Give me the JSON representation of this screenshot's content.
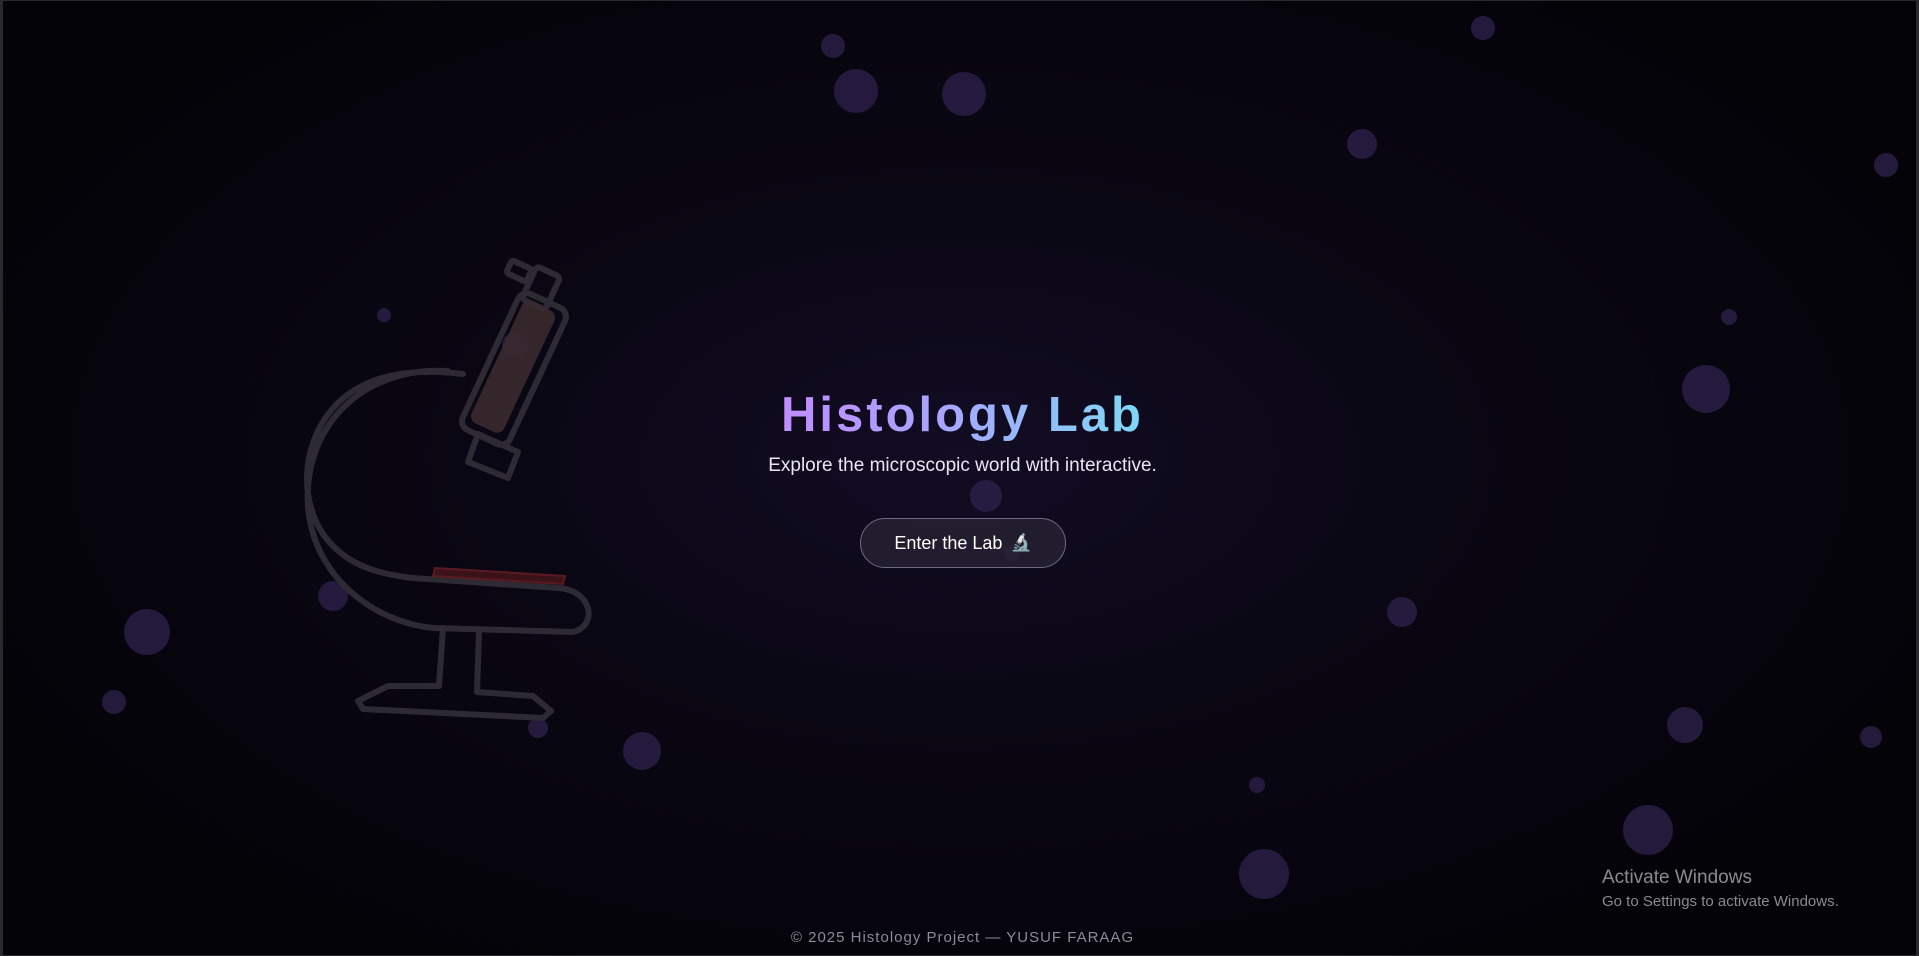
{
  "hero": {
    "title": "Histology Lab",
    "subtitle": "Explore the microscopic world with interactive."
  },
  "cta": {
    "label": "Enter the Lab",
    "icon": "microscope-icon",
    "icon_glyph": "🔬"
  },
  "footer": {
    "text": "© 2025 Histology Project — YUSUF FARAAG"
  },
  "os_watermark": {
    "title": "Activate Windows",
    "subtitle": "Go to Settings to activate Windows."
  },
  "colors": {
    "background": "#05040b",
    "title_gradient_start": "#c18cff",
    "title_gradient_end": "#7ed8f5",
    "bubble": "#2a1e45"
  }
}
